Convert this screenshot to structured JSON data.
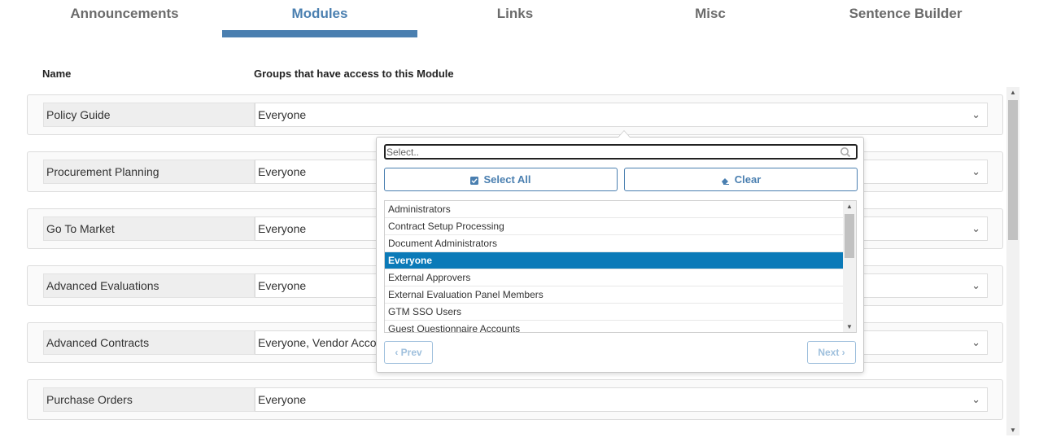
{
  "tabs": [
    {
      "label": "Announcements"
    },
    {
      "label": "Modules"
    },
    {
      "label": "Links"
    },
    {
      "label": "Misc"
    },
    {
      "label": "Sentence Builder"
    }
  ],
  "active_tab": "Modules",
  "columns": {
    "name": "Name",
    "groups": "Groups that have access to this Module"
  },
  "modules": [
    {
      "name": "Policy Guide",
      "groups": "Everyone"
    },
    {
      "name": "Procurement Planning",
      "groups": "Everyone"
    },
    {
      "name": "Go To Market",
      "groups": "Everyone"
    },
    {
      "name": "Advanced Evaluations",
      "groups": "Everyone"
    },
    {
      "name": "Advanced Contracts",
      "groups": "Everyone, Vendor Accou"
    },
    {
      "name": "Purchase Orders",
      "groups": "Everyone"
    }
  ],
  "dropdown": {
    "search_placeholder": "Select..",
    "select_all_label": "Select All",
    "clear_label": "Clear",
    "options": [
      {
        "label": "Administrators",
        "selected": false
      },
      {
        "label": "Contract Setup Processing",
        "selected": false
      },
      {
        "label": "Document Administrators",
        "selected": false
      },
      {
        "label": "Everyone",
        "selected": true
      },
      {
        "label": "External Approvers",
        "selected": false
      },
      {
        "label": "External Evaluation Panel Members",
        "selected": false
      },
      {
        "label": "GTM SSO Users",
        "selected": false
      },
      {
        "label": "Guest Questionnaire Accounts",
        "selected": false
      }
    ],
    "prev_label": "Prev",
    "next_label": "Next"
  },
  "colors": {
    "accent": "#4a7fb0",
    "selected_bg": "#0b7ab8"
  }
}
